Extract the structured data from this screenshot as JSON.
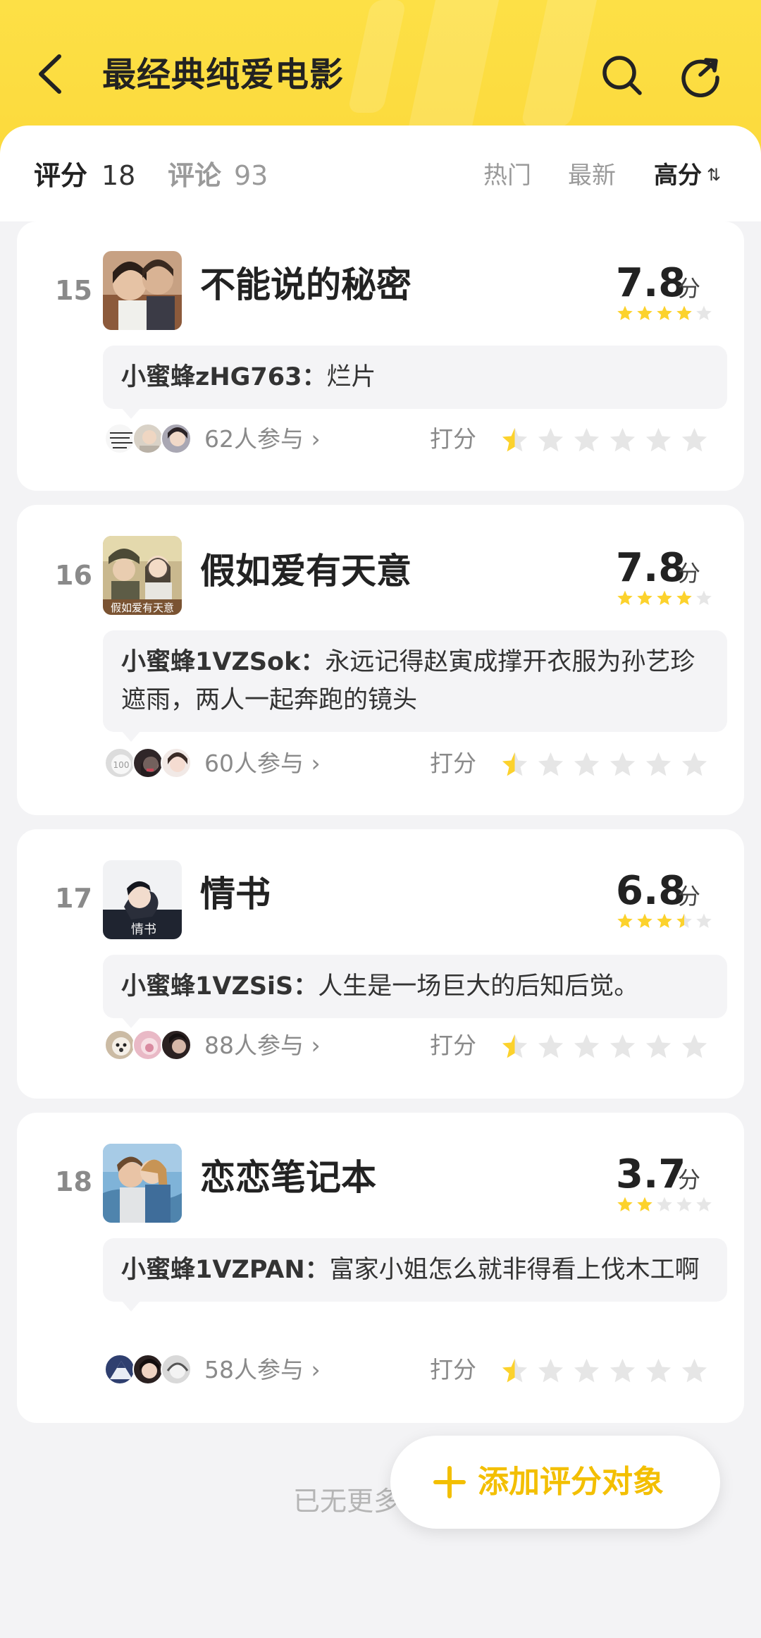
{
  "header": {
    "title": "最经典纯爱电影"
  },
  "tabs": {
    "score_label": "评分",
    "score_count": "18",
    "comment_label": "评论",
    "comment_count": "93",
    "sort_hot": "热门",
    "sort_new": "最新",
    "sort_high": "高分",
    "sort_arrow": "⇅"
  },
  "items": [
    {
      "rank": "15",
      "title": "不能说的秘密",
      "score": "7.8",
      "unit": "分",
      "stars": 4,
      "comment_user": "小蜜蜂zHG763：",
      "comment_text": "烂片",
      "participants": "62人参与",
      "rate_label": "打分"
    },
    {
      "rank": "16",
      "title": "假如爱有天意",
      "score": "7.8",
      "unit": "分",
      "stars": 4,
      "comment_user": "小蜜蜂1VZSok：",
      "comment_text": "永远记得赵寅成撑开衣服为孙艺珍遮雨，两人一起奔跑的镜头",
      "participants": "60人参与",
      "rate_label": "打分"
    },
    {
      "rank": "17",
      "title": "情书",
      "score": "6.8",
      "unit": "分",
      "stars": 3.5,
      "comment_user": "小蜜蜂1VZSiS：",
      "comment_text": "人生是一场巨大的后知后觉。",
      "participants": "88人参与",
      "rate_label": "打分"
    },
    {
      "rank": "18",
      "title": "恋恋笔记本",
      "score": "3.7",
      "unit": "分",
      "stars": 2,
      "comment_user": "小蜜蜂1VZPAN：",
      "comment_text": "富家小姐怎么就非得看上伐木工啊",
      "participants": "58人参与",
      "rate_label": "打分"
    }
  ],
  "footer": {
    "no_more": "已无更多",
    "add_button": "添加评分对象"
  },
  "colors": {
    "accent": "#fcd83c",
    "star": "#fcd22c",
    "star_empty": "#e6e6e6",
    "add_text": "#f3bf00"
  },
  "icons": {
    "back": "back-arrow-icon",
    "search": "search-icon",
    "refresh": "refresh-icon",
    "plus": "plus-icon",
    "star": "star-icon",
    "chevron": "chevron-right-icon"
  }
}
